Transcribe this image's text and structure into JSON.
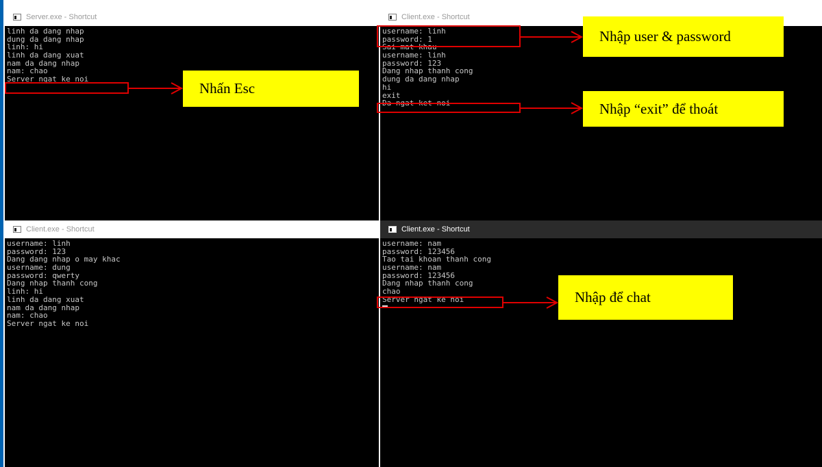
{
  "windows": {
    "server": {
      "title": "Server.exe - Shortcut",
      "lines": [
        "linh da dang nhap",
        "dung da dang nhap",
        "linh: hi",
        "linh da dang xuat",
        "nam da dang nhap",
        "nam: chao",
        "Server ngat ke noi"
      ]
    },
    "client_top": {
      "title": "Client.exe - Shortcut",
      "lines": [
        "username: linh",
        "password: 1",
        "Sai mat khau",
        "username: linh",
        "password: 123",
        "Dang nhap thanh cong",
        "dung da dang nhap",
        "hi",
        "exit",
        "Da ngat ket noi"
      ]
    },
    "client_bottom_left": {
      "title": "Client.exe - Shortcut",
      "lines": [
        "username: linh",
        "password: 123",
        "Dang dang nhap o may khac",
        "username: dung",
        "password: qwerty",
        "Dang nhap thanh cong",
        "linh: hi",
        "linh da dang xuat",
        "nam da dang nhap",
        "nam: chao",
        "Server ngat ke noi"
      ]
    },
    "client_bottom_right": {
      "title": "Client.exe - Shortcut",
      "lines": [
        "username: nam",
        "password: 123456",
        "Tao tai khoan thanh cong",
        "username: nam",
        "password: 123456",
        "Dang nhap thanh cong",
        "chao",
        "Server ngat ke noi"
      ]
    }
  },
  "annotations": {
    "esc": "Nhấn Esc",
    "login": "Nhập user & password",
    "exit": "Nhập “exit” để thoát",
    "chat": "Nhập để chat"
  },
  "colors": {
    "console_bg": "#000000",
    "console_text": "#c8c8c8",
    "highlight": "#e00000",
    "callout_bg": "#ffff00",
    "taskbar_accent": "#0063b1"
  }
}
